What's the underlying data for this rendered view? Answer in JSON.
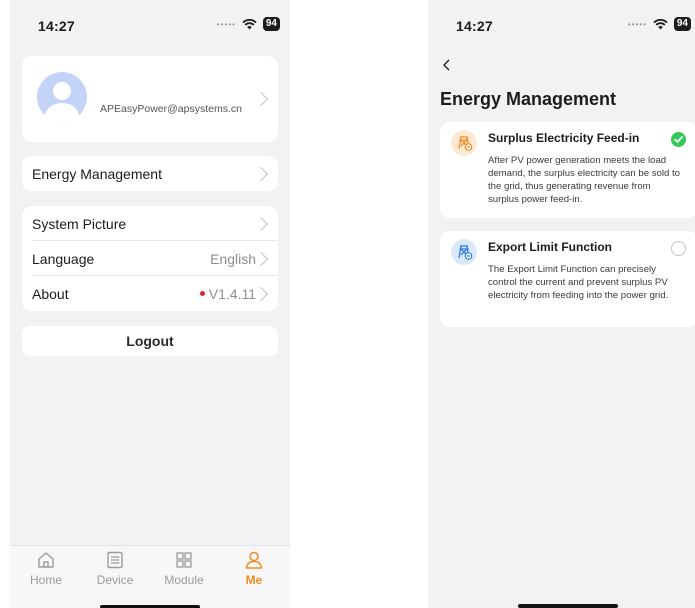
{
  "left": {
    "status": {
      "time": "14:27",
      "battery": "94"
    },
    "profile": {
      "email": "APEasyPower@apsystems.cn"
    },
    "menu": {
      "energy_management": "Energy Management",
      "system_picture": "System Picture",
      "language": {
        "label": "Language",
        "value": "English"
      },
      "about": {
        "label": "About",
        "value": "V1.4.11"
      }
    },
    "logout": "Logout",
    "tabs": [
      {
        "label": "Home",
        "icon": "home-icon"
      },
      {
        "label": "Device",
        "icon": "device-icon"
      },
      {
        "label": "Module",
        "icon": "module-icon"
      },
      {
        "label": "Me",
        "icon": "person-icon",
        "active": true
      }
    ]
  },
  "right": {
    "status": {
      "time": "14:27",
      "battery": "94"
    },
    "title": "Energy Management",
    "options": [
      {
        "title": "Surplus Electricity Feed-in",
        "description": "After PV power generation meets the load demand, the surplus electricity can be sold to the grid, thus generating revenue from surplus power feed-in.",
        "selected": true,
        "icon": "tower-feedin-icon"
      },
      {
        "title": "Export Limit Function",
        "description": "The Export Limit Function can precisely control the current and prevent surplus PV electricity from feeding into the power grid.",
        "selected": false,
        "icon": "tower-limit-icon"
      }
    ]
  },
  "colors": {
    "accent": "#f08c24",
    "check": "#34c759",
    "limit_icon": "#2f7de1",
    "feedin_icon": "#f08c24",
    "red_dot": "#e3242b"
  }
}
